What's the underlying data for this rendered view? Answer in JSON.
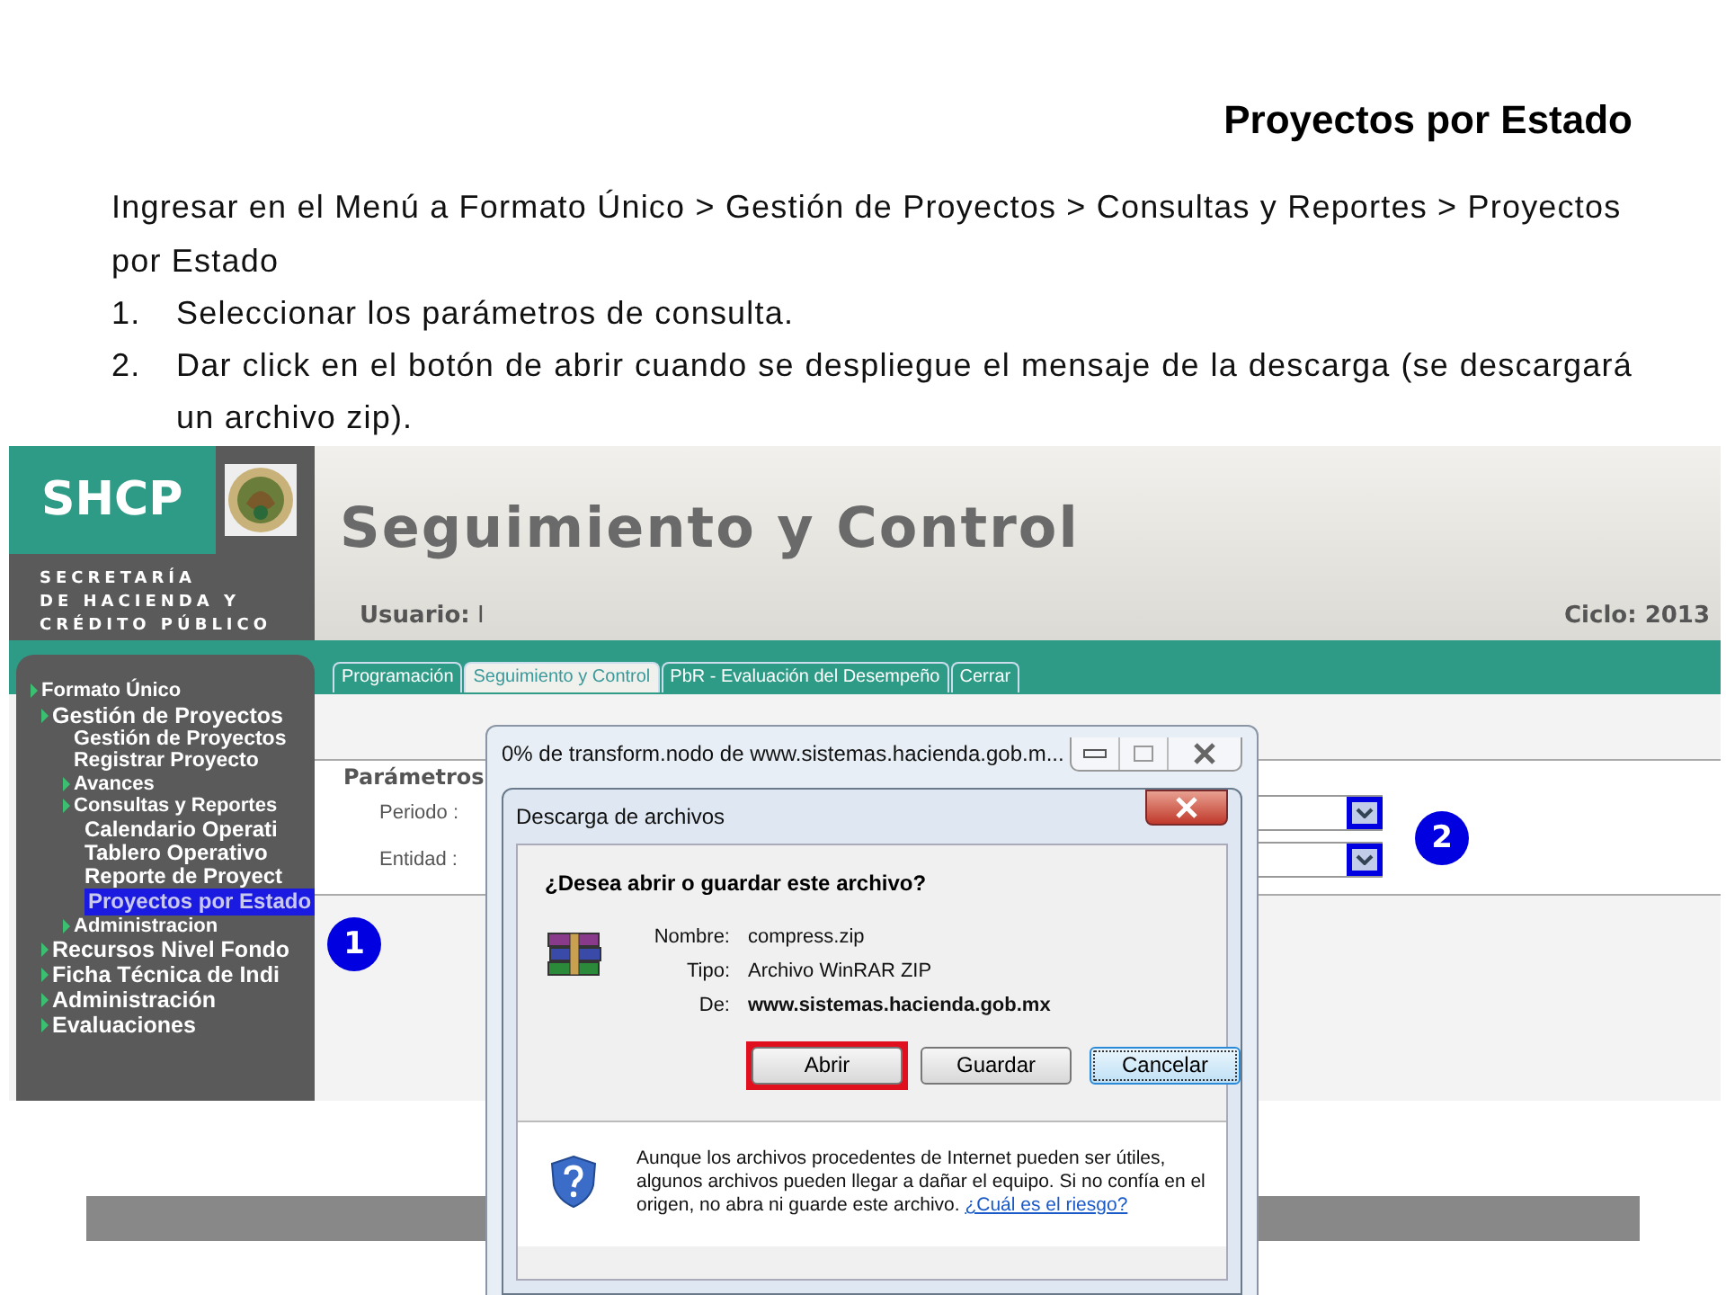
{
  "slide": {
    "title": "Proyectos por Estado",
    "intro": "Ingresar en el Menú a Formato Único > Gestión de Proyectos > Consultas y Reportes > Proyectos por Estado",
    "steps": [
      {
        "number": "1.",
        "text": "Seleccionar los parámetros de consulta."
      },
      {
        "number": "2.",
        "text": "Dar click en el botón de abrir cuando se despliegue el mensaje de la descarga (se descargará un archivo zip)."
      }
    ]
  },
  "app": {
    "logo": "SHCP",
    "agency": [
      "SECRETARÍA",
      "DE HACIENDA Y",
      "CRÉDITO PÚBLICO"
    ],
    "system_title": "Seguimiento y Control",
    "user_label": "Usuario:",
    "user_value": "I",
    "cycle": "Ciclo: 2013",
    "tabs": [
      {
        "label": "Programación",
        "selected": false
      },
      {
        "label": "Seguimiento y Control",
        "selected": true
      },
      {
        "label": "PbR - Evaluación del Desempeño",
        "selected": false
      },
      {
        "label": "Cerrar",
        "selected": false
      }
    ],
    "menu": [
      {
        "label": "Formato Único",
        "kind": "folder",
        "selected": false,
        "children": [
          {
            "label": "Gestión de Proyectos",
            "kind": "folder",
            "selected": false,
            "children": [
              {
                "label": "Gestión de Proyectos",
                "kind": "leaf",
                "selected": false
              },
              {
                "label": "Registrar Proyecto",
                "kind": "leaf",
                "selected": false
              },
              {
                "label": "Avances",
                "kind": "folder",
                "selected": false
              },
              {
                "label": "Consultas y Reportes",
                "kind": "folder",
                "selected": false,
                "children": [
                  {
                    "label": "Calendario Operati",
                    "kind": "leaf",
                    "selected": false
                  },
                  {
                    "label": "Tablero Operativo",
                    "kind": "leaf",
                    "selected": false
                  },
                  {
                    "label": "Reporte de Proyect",
                    "kind": "leaf",
                    "selected": false
                  },
                  {
                    "label": "Proyectos por Estado",
                    "kind": "leaf",
                    "selected": true
                  }
                ]
              },
              {
                "label": "Administracion",
                "kind": "folder",
                "selected": false
              }
            ]
          },
          {
            "label": "Recursos Nivel Fondo",
            "kind": "folder",
            "selected": false
          },
          {
            "label": "Ficha Técnica de Indi",
            "kind": "folder",
            "selected": false
          },
          {
            "label": "Administración",
            "kind": "folder",
            "selected": false
          },
          {
            "label": "Evaluaciones",
            "kind": "folder",
            "selected": false
          }
        ]
      }
    ],
    "params": {
      "title": "Parámetros",
      "fields": [
        {
          "label": "Periodo :"
        },
        {
          "label": "Entidad :"
        }
      ]
    },
    "callouts": [
      {
        "number": "1"
      },
      {
        "number": "2"
      }
    ]
  },
  "browser_window": {
    "title": "0% de transform.nodo de www.sistemas.hacienda.gob.m..."
  },
  "dialog": {
    "title": "Descarga de archivos",
    "question": "¿Desea abrir o guardar este archivo?",
    "details": [
      {
        "label": "Nombre:",
        "value": "compress.zip",
        "bold": false
      },
      {
        "label": "Tipo:",
        "value": "Archivo WinRAR ZIP",
        "bold": false
      },
      {
        "label": "De:",
        "value": "www.sistemas.hacienda.gob.mx",
        "bold": true
      }
    ],
    "buttons": [
      {
        "label": "Abrir",
        "highlighted": true,
        "focused": false
      },
      {
        "label": "Guardar",
        "highlighted": false,
        "focused": false
      },
      {
        "label": "Cancelar",
        "highlighted": false,
        "focused": true
      }
    ],
    "warning": "Aunque los archivos procedentes de Internet pueden ser útiles, algunos archivos pueden llegar a dañar el equipo. Si no confía en el origen, no abra ni guarde este archivo.",
    "link": "¿Cuál es el riesgo?"
  }
}
